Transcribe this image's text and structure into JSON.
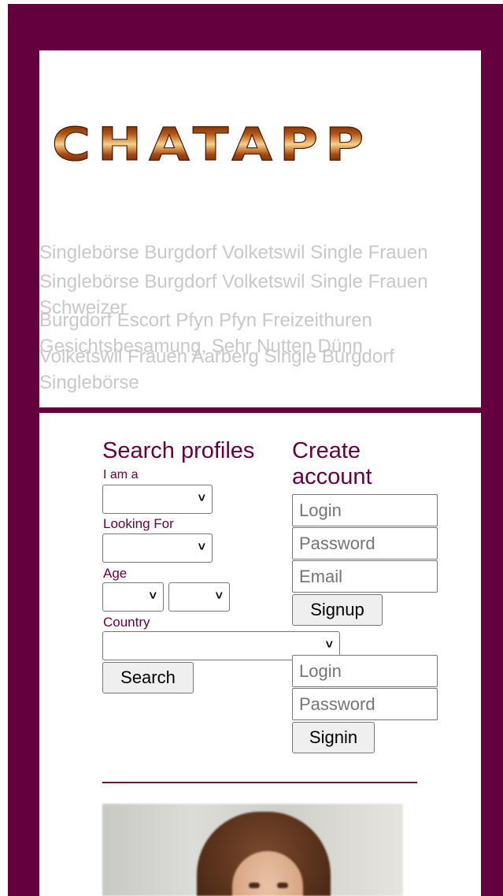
{
  "logo": {
    "text": "CHATAPP"
  },
  "seo_text": [
    "Singlebörse Burgdorf Volketswil Single Frauen",
    "Singlebörse Burgdorf Volketswil Single Frauen Schweizer",
    "Burgdorf Escort Pfyn Pfyn Freizeithuren Gesichtsbesamung, Sehr Nutten Dünn",
    "Volketswil Frauen Aarberg Single Burgdorf Singlebörse"
  ],
  "search": {
    "heading": "Search profiles",
    "i_am_label": "I am a",
    "looking_for_label": "Looking For",
    "age_label": "Age",
    "country_label": "Country",
    "button_label": "Search"
  },
  "create_account": {
    "heading": "Create account",
    "login_placeholder": "Login",
    "password_placeholder": "Password",
    "email_placeholder": "Email",
    "button_label": "Signup"
  },
  "signin": {
    "login_placeholder": "Login",
    "password_placeholder": "Password",
    "button_label": "Signin"
  },
  "colors": {
    "brand": "#66003c",
    "seo_text": "#c8c8c8"
  }
}
